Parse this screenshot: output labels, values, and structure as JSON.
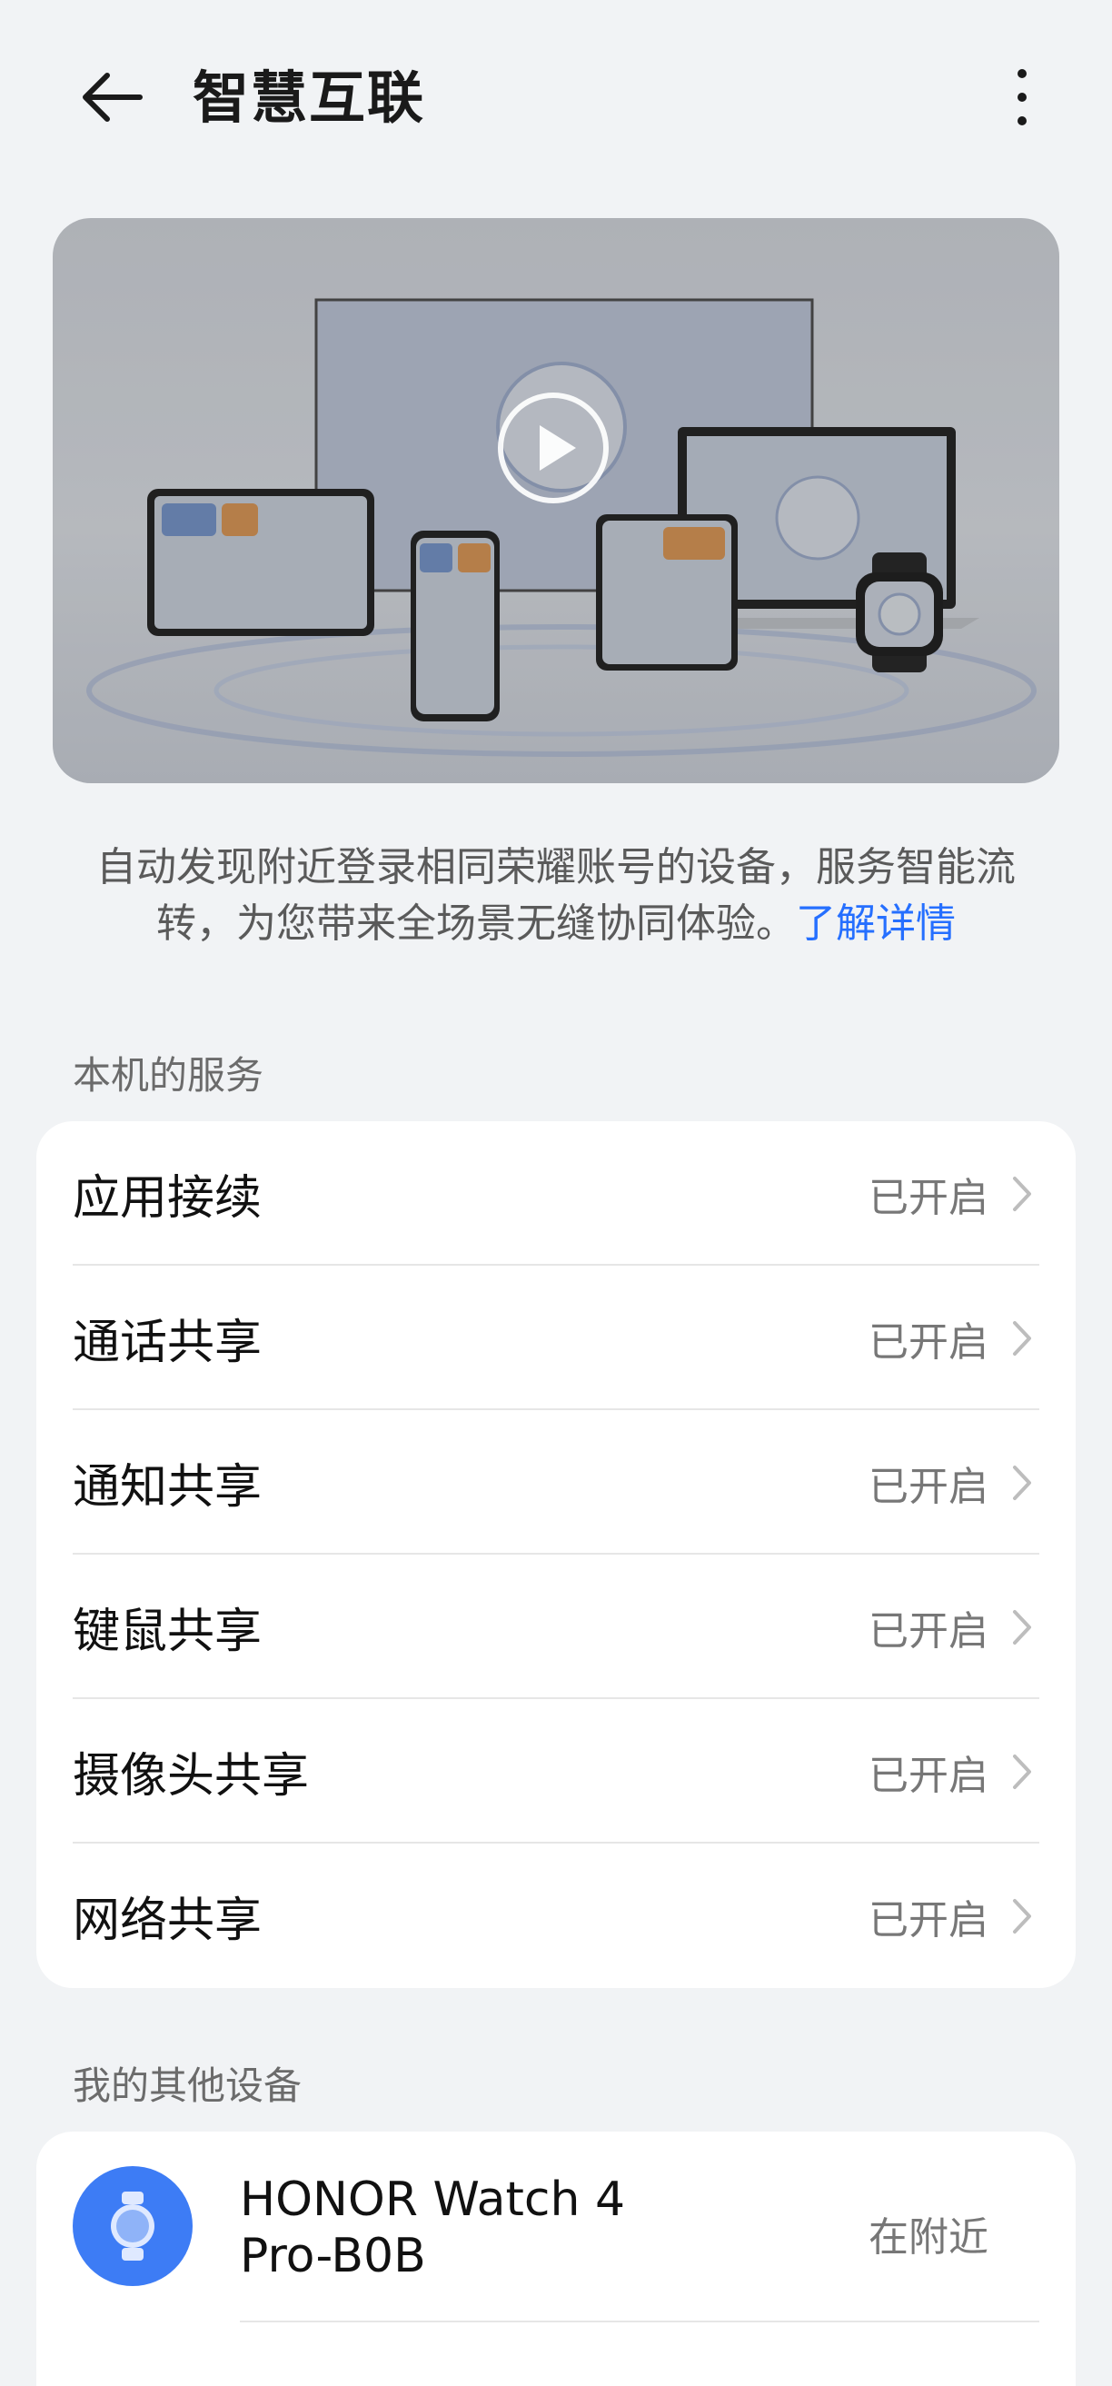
{
  "header": {
    "title": "智慧互联",
    "back_icon": "arrow-left-icon",
    "more_icon": "more-vertical-icon"
  },
  "hero": {
    "play_icon": "play-icon"
  },
  "description": {
    "text": "自动发现附近登录相同荣耀账号的设备，服务智能流转，为您带来全场景无缝协同体验。",
    "link": "了解详情"
  },
  "local_services": {
    "section_title": "本机的服务",
    "items": [
      {
        "label": "应用接续",
        "status": "已开启"
      },
      {
        "label": "通话共享",
        "status": "已开启"
      },
      {
        "label": "通知共享",
        "status": "已开启"
      },
      {
        "label": "键鼠共享",
        "status": "已开启"
      },
      {
        "label": "摄像头共享",
        "status": "已开启"
      },
      {
        "label": "网络共享",
        "status": "已开启"
      }
    ]
  },
  "other_devices": {
    "section_title": "我的其他设备",
    "items": [
      {
        "name": "HONOR Watch 4 Pro-B0B",
        "status": "在附近",
        "icon": "watch-icon"
      }
    ]
  },
  "colors": {
    "background": "#f1f3f5",
    "card": "#ffffff",
    "accent": "#256fff",
    "device_avatar": "#3d7cf5",
    "secondary_text": "#777777"
  }
}
